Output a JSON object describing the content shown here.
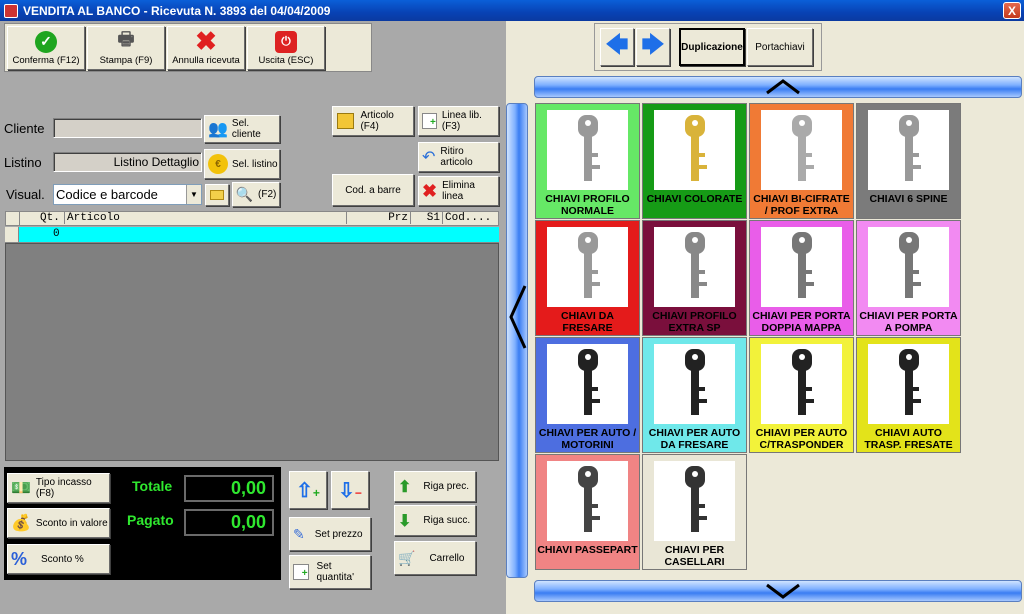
{
  "window": {
    "title": "VENDITA AL BANCO - Ricevuta N. 3893 del 04/04/2009",
    "close": "X"
  },
  "toolbar": {
    "confirm": "Conferma (F12)",
    "print": "Stampa (F9)",
    "cancel": "Annulla ricevuta",
    "exit": "Uscita (ESC)"
  },
  "nav": {
    "dup": "Duplicazione",
    "portachiavi": "Portachiavi"
  },
  "customer": {
    "cliente_label": "Cliente",
    "cliente_value": "",
    "sel_cliente": "Sel. cliente",
    "listino_label": "Listino",
    "listino_value": "Listino Dettaglio",
    "sel_listino": "Sel. listino",
    "visual_label": "Visual.",
    "visual_value": "Codice e barcode",
    "f2": "(F2)"
  },
  "actions": {
    "articolo": "Articolo (F4)",
    "linea_lib": "Linea lib. (F3)",
    "ritiro": "Ritiro articolo",
    "cod_barre": "Cod. a barre",
    "elimina": "Elimina linea"
  },
  "grid": {
    "headers": {
      "qt": "Qt.",
      "articolo": "Articolo",
      "prz": "Prz",
      "s1": "S1",
      "cod": "Cod...."
    },
    "row0_qt": "0"
  },
  "totals": {
    "tipo_incasso": "Tipo incasso (F8)",
    "sconto_valore": "Sconto in valore",
    "sconto_pct": "Sconto %",
    "totale_label": "Totale",
    "totale_value": "0,00",
    "pagato_label": "Pagato",
    "pagato_value": "0,00"
  },
  "qty": {
    "set_prezzo": "Set prezzo",
    "set_quantita": "Set quantita'",
    "riga_prec": "Riga prec.",
    "riga_succ": "Riga succ.",
    "carrello": "Carrello"
  },
  "categories": [
    {
      "name": "CHIAVI PROFILO NORMALE",
      "color": "#66e866",
      "key": "#999"
    },
    {
      "name": "CHIAVI COLORATE",
      "color": "#169b16",
      "key": "#d9b33a"
    },
    {
      "name": "CHIAVI BI-CIFRATE / PROF EXTRA",
      "color": "#f07a35",
      "key": "#aaa"
    },
    {
      "name": "CHIAVI 6 SPINE",
      "color": "#7b7b7b",
      "key": "#999"
    },
    {
      "name": "CHIAVI DA FRESARE",
      "color": "#e41b1b",
      "key": "#999"
    },
    {
      "name": "CHIAVI PROFILO EXTRA SP",
      "color": "#7a0f3c",
      "key": "#888"
    },
    {
      "name": "CHIAVI PER PORTA DOPPIA MAPPA",
      "color": "#e95de9",
      "key": "#777"
    },
    {
      "name": "CHIAVI PER PORTA A POMPA",
      "color": "#f28af2",
      "key": "#777"
    },
    {
      "name": "CHIAVI PER AUTO / MOTORINI",
      "color": "#4d6ee0",
      "key": "#222"
    },
    {
      "name": "CHIAVI PER AUTO DA FRESARE",
      "color": "#6fe8ea",
      "key": "#222"
    },
    {
      "name": "CHIAVI PER AUTO C/TRASPONDER",
      "color": "#f2f23a",
      "key": "#222"
    },
    {
      "name": "CHIAVI AUTO TRASP. FRESATE",
      "color": "#e3e31a",
      "key": "#222"
    },
    {
      "name": "CHIAVI PASSEPART",
      "color": "#f08484",
      "key": "#444"
    },
    {
      "name": "CHIAVI PER CASELLARI",
      "color": "#e9e6d6",
      "key": "#333"
    }
  ]
}
